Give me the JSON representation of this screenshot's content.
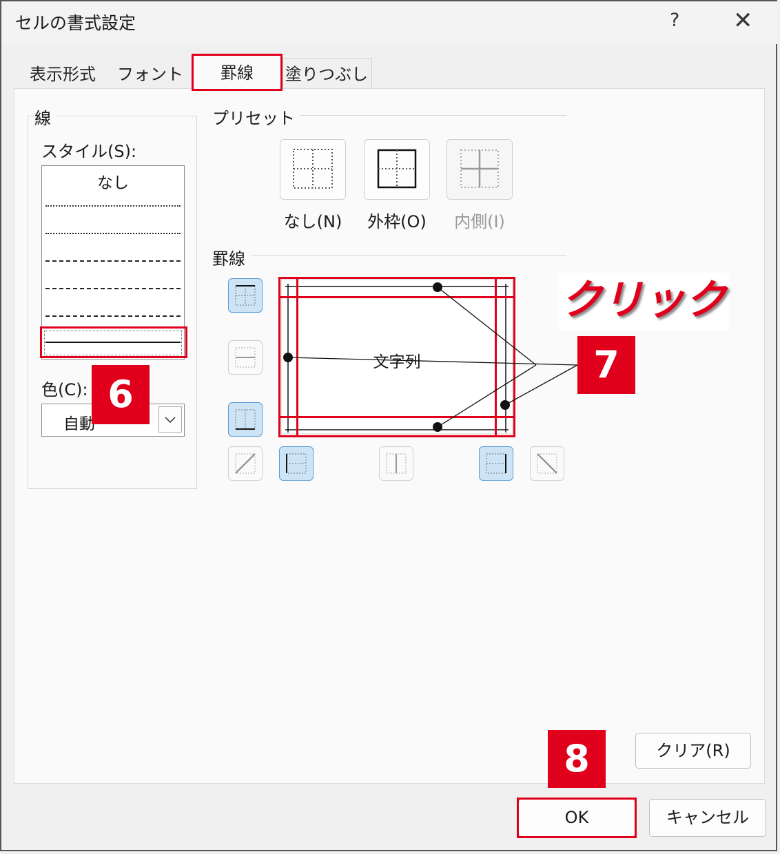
{
  "dialog": {
    "title": "セルの書式設定",
    "help": "?",
    "close": "✕"
  },
  "tabs": [
    {
      "label": "表示形式"
    },
    {
      "label": "フォント"
    },
    {
      "label": "罫線"
    },
    {
      "label": "塗りつぶし"
    }
  ],
  "line_group": {
    "legend": "線",
    "style_label": "スタイル(S):",
    "none_label": "なし",
    "color_label": "色(C):",
    "color_value": "自動"
  },
  "preset_group": {
    "legend": "プリセット",
    "none": "なし(N)",
    "outline": "外枠(O)",
    "inside": "内側(I)"
  },
  "border_group": {
    "legend": "罫線",
    "preview_text": "文字列"
  },
  "buttons": {
    "clear": "クリア(R)",
    "ok": "OK",
    "cancel": "キャンセル"
  },
  "annotations": {
    "step6": "6",
    "step7": "7",
    "step8": "8",
    "click": "クリック"
  },
  "colors": {
    "accent_red": "#e0001b",
    "selected_blue": "#cde4f7"
  }
}
